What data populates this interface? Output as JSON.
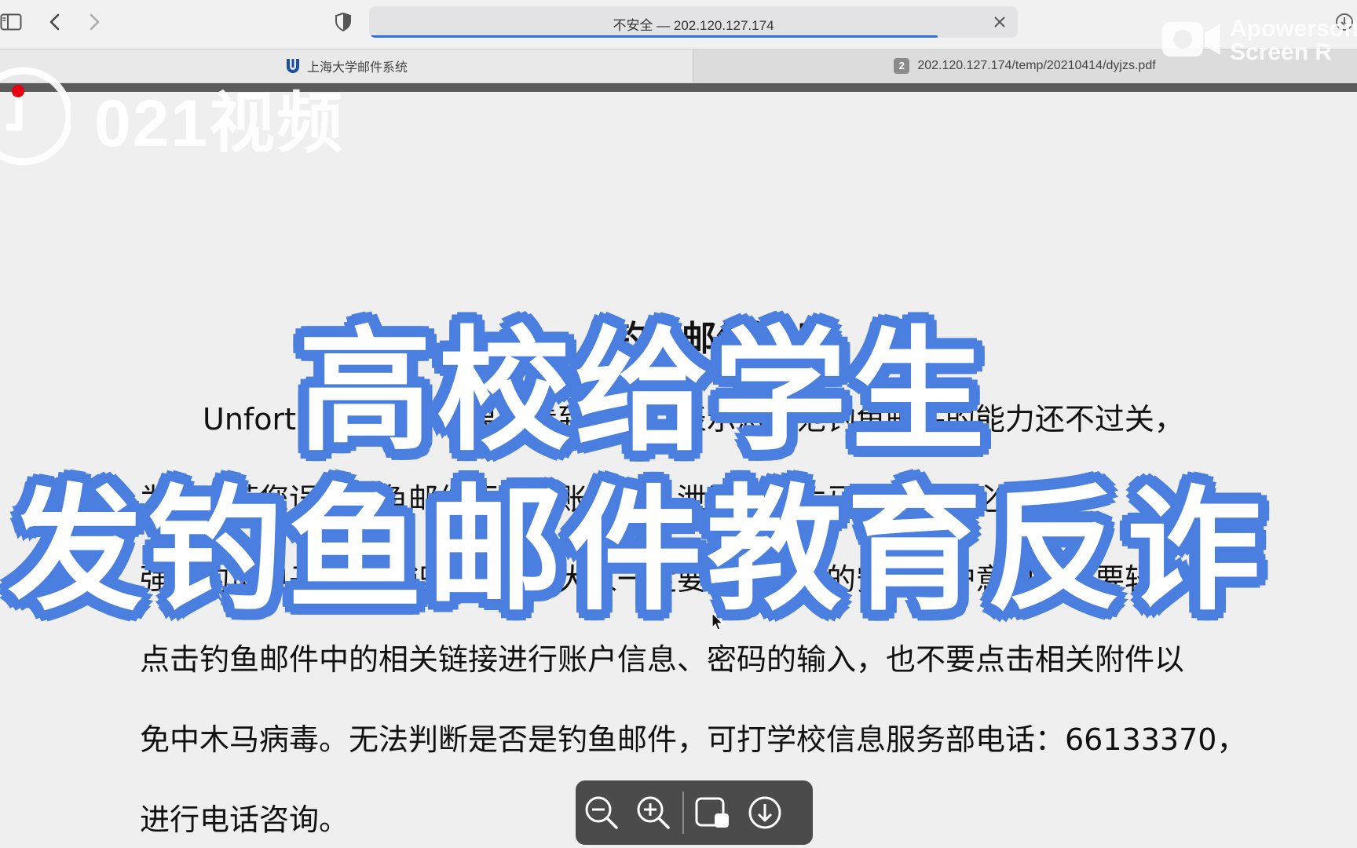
{
  "browser": {
    "address_text": "不安全 — 202.120.127.174",
    "tabs": [
      {
        "label": "上海大学邮件系统",
        "active": true
      },
      {
        "badge": "2",
        "label": "202.120.127.174/temp/20210414/dyjzs.pdf",
        "active": false
      }
    ]
  },
  "document": {
    "title": "钓鱼邮件知识",
    "lines": [
      "Unfortunately，如果您看到本文，表示您防范钓鱼邮件的能力还不过关，",
      "为了防范您误入钓鱼邮件而导致账户信息泄露或中木马病毒，有必要加",
      "强对钓鱼电子邮件知识的学习，大家一定要增强自己的安全防护意识，不要轻易",
      "点击钓鱼邮件中的相关链接进行账户信息、密码的输入，也不要点击相关附件以",
      "免中木马病毒。无法判断是否是钓鱼邮件，可打学校信息服务部电话：66133370，",
      "进行电话咨询。"
    ]
  },
  "captions": {
    "line1": "高校给学生",
    "line2": "发钓鱼邮件教育反诈"
  },
  "watermarks": {
    "channel": "021视频",
    "recorder_line1": "Apowersoft",
    "recorder_line2": "Screen R"
  },
  "pdf_toolbar": {
    "buttons": [
      "zoom-out-icon",
      "zoom-in-icon",
      "markup-icon",
      "download-icon"
    ]
  },
  "colors": {
    "caption_fill": "#ffffff",
    "caption_outline": "#4a7fe0",
    "progress": "#2f6fe6",
    "record_dot": "#e60012"
  }
}
